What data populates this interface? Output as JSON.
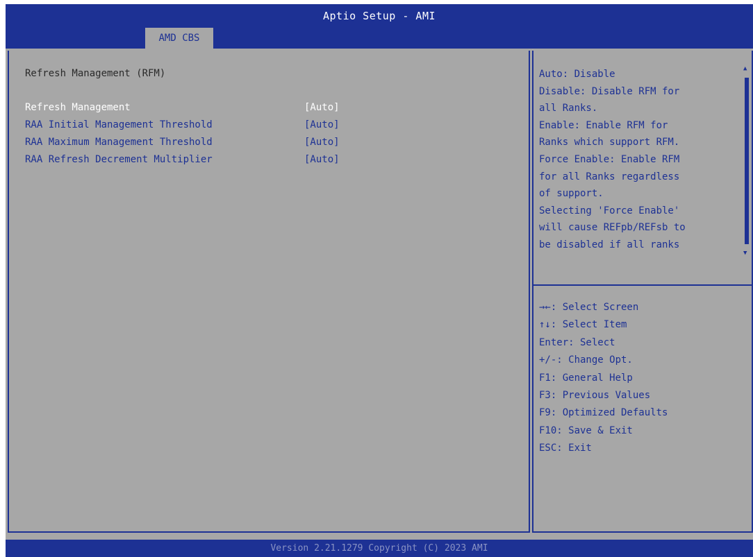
{
  "header": {
    "title": "Aptio Setup - AMI",
    "tab": "AMD CBS"
  },
  "main": {
    "section_title": "Refresh Management (RFM)",
    "items": [
      {
        "label": "Refresh Management",
        "value": "[Auto]",
        "selected": true
      },
      {
        "label": "RAA Initial Management Threshold",
        "value": "[Auto]"
      },
      {
        "label": "RAA Maximum Management Threshold",
        "value": "[Auto]"
      },
      {
        "label": "RAA Refresh Decrement Multiplier",
        "value": "[Auto]"
      }
    ]
  },
  "help": {
    "lines": [
      "Auto: Disable",
      "Disable: Disable RFM for",
      "all Ranks.",
      "Enable: Enable RFM for",
      "Ranks which support RFM.",
      "Force Enable: Enable RFM",
      "for all Ranks regardless",
      "of support.",
      "Selecting 'Force Enable'",
      "will cause REFpb/REFsb to",
      "be disabled if all ranks"
    ]
  },
  "keys": [
    "→←: Select Screen",
    "↑↓: Select Item",
    "Enter: Select",
    "+/-: Change Opt.",
    "F1: General Help",
    "F3: Previous Values",
    "F9: Optimized Defaults",
    "F10: Save & Exit",
    "ESC: Exit"
  ],
  "footer": {
    "text": "Version 2.21.1279 Copyright (C) 2023 AMI"
  },
  "colors": {
    "bios_blue": "#1d3194",
    "panel_gray": "#a7a7a7",
    "selected_text": "#ffffff"
  }
}
